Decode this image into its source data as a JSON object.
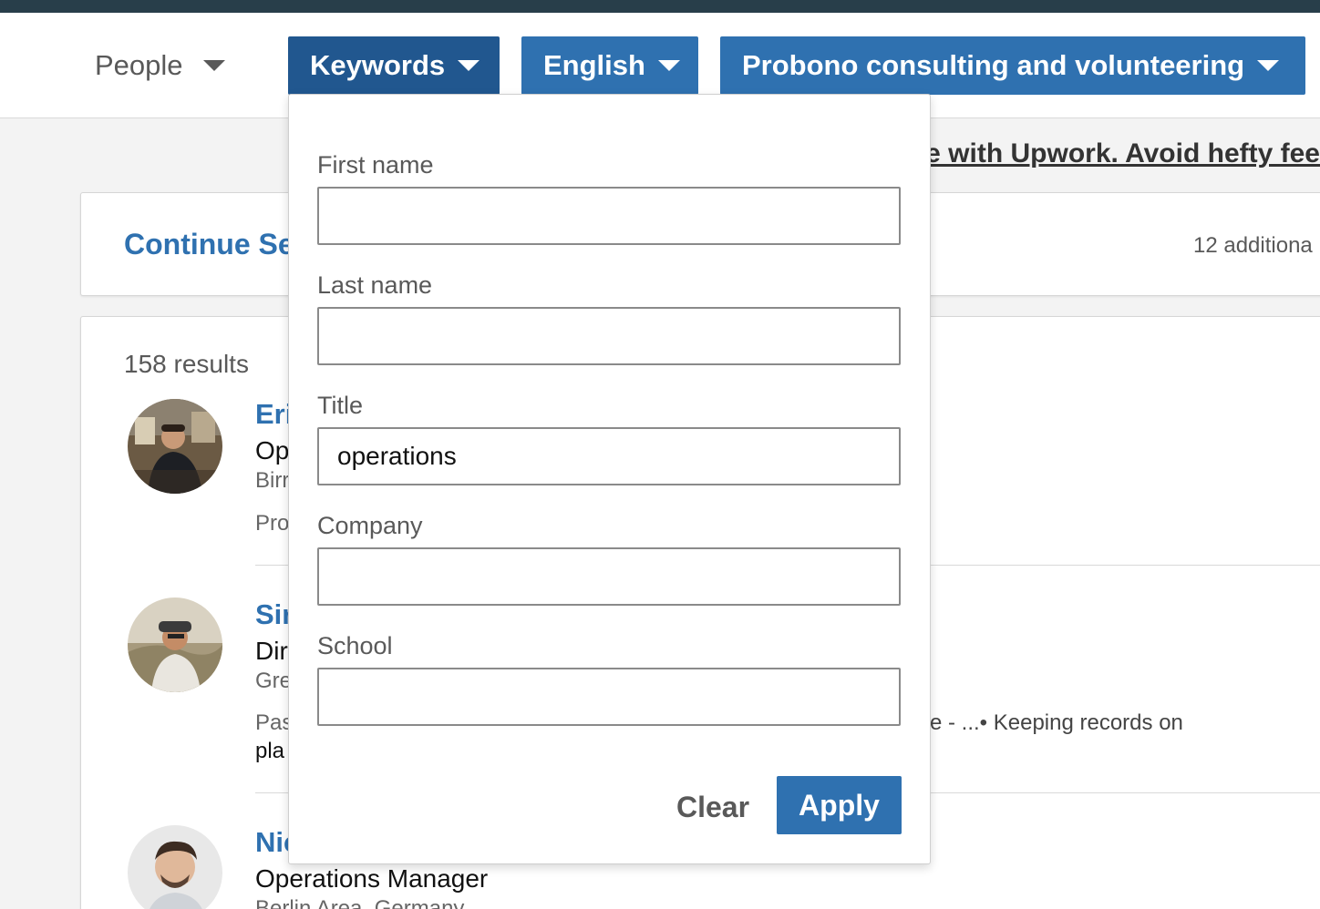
{
  "filters": {
    "people": "People",
    "keywords": "Keywords",
    "language": "English",
    "interest": "Probono consulting and volunteering"
  },
  "banner": {
    "upwork_text": "e with Upwork. Avoid hefty fee"
  },
  "search_card": {
    "continue_label": "Continue Se",
    "additional_text": "12 additiona"
  },
  "results": {
    "count_text": "158 results",
    "rows": [
      {
        "name": "Eri",
        "title": "Op",
        "location": "Birr",
        "snippet": "Pro"
      },
      {
        "name": "Sir",
        "title": "Dir",
        "location": "Gre",
        "snippet": "Pas",
        "snippet2": "pla",
        "snippet_tail": "e - ...• Keeping records on"
      },
      {
        "name": "Nic",
        "title": "Operations Manager",
        "location": "Berlin Area, Germany"
      }
    ]
  },
  "keywords_panel": {
    "first_name": {
      "label": "First name",
      "value": ""
    },
    "last_name": {
      "label": "Last name",
      "value": ""
    },
    "title": {
      "label": "Title",
      "value": "operations"
    },
    "company": {
      "label": "Company",
      "value": ""
    },
    "school": {
      "label": "School",
      "value": ""
    },
    "clear_label": "Clear",
    "apply_label": "Apply"
  },
  "colors": {
    "accent": "#2f71b0",
    "accent_active": "#21578f",
    "topbar": "#283e4a"
  }
}
